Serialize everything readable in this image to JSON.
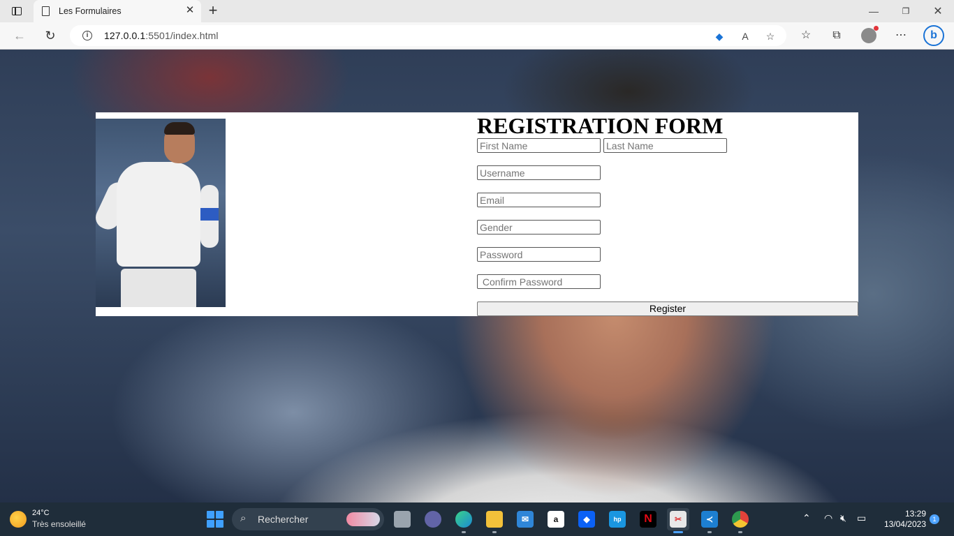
{
  "browser": {
    "tab_title": "Les Formulaires",
    "url_host": "127.0.0.1",
    "url_rest": ":5501/index.html"
  },
  "form": {
    "title": "REGISTRATION FORM",
    "first_name_placeholder": "First Name",
    "last_name_placeholder": "Last Name",
    "username_placeholder": "Username",
    "email_placeholder": "Email",
    "gender_placeholder": "Gender",
    "password_placeholder": "Password",
    "confirm_password_placeholder": " Confirm Password",
    "register_label": "Register"
  },
  "taskbar": {
    "temperature": "24°C",
    "weather_condition": "Très ensoleillé",
    "search_label": "Rechercher",
    "time": "13:29",
    "date": "13/04/2023",
    "notification_count": "1",
    "apps": [
      {
        "name": "file-explorer-grey",
        "color": "#9aa4ae"
      },
      {
        "name": "teams",
        "color": "#6264a7"
      },
      {
        "name": "edge",
        "color": "#1b8ad3"
      },
      {
        "name": "file-explorer",
        "color": "#f3c13a"
      },
      {
        "name": "mail",
        "color": "#2f86d8"
      },
      {
        "name": "amazon",
        "color": "#ffffff"
      },
      {
        "name": "dropbox",
        "color": "#0b61f5"
      },
      {
        "name": "myhp",
        "color": "#1a96e0"
      },
      {
        "name": "netflix",
        "color": "#000000"
      },
      {
        "name": "snipping-tool",
        "color": "#e8e8e8"
      },
      {
        "name": "vscode",
        "color": "#1d7fd1"
      },
      {
        "name": "chrome",
        "color": "#2e9a4f"
      }
    ]
  }
}
